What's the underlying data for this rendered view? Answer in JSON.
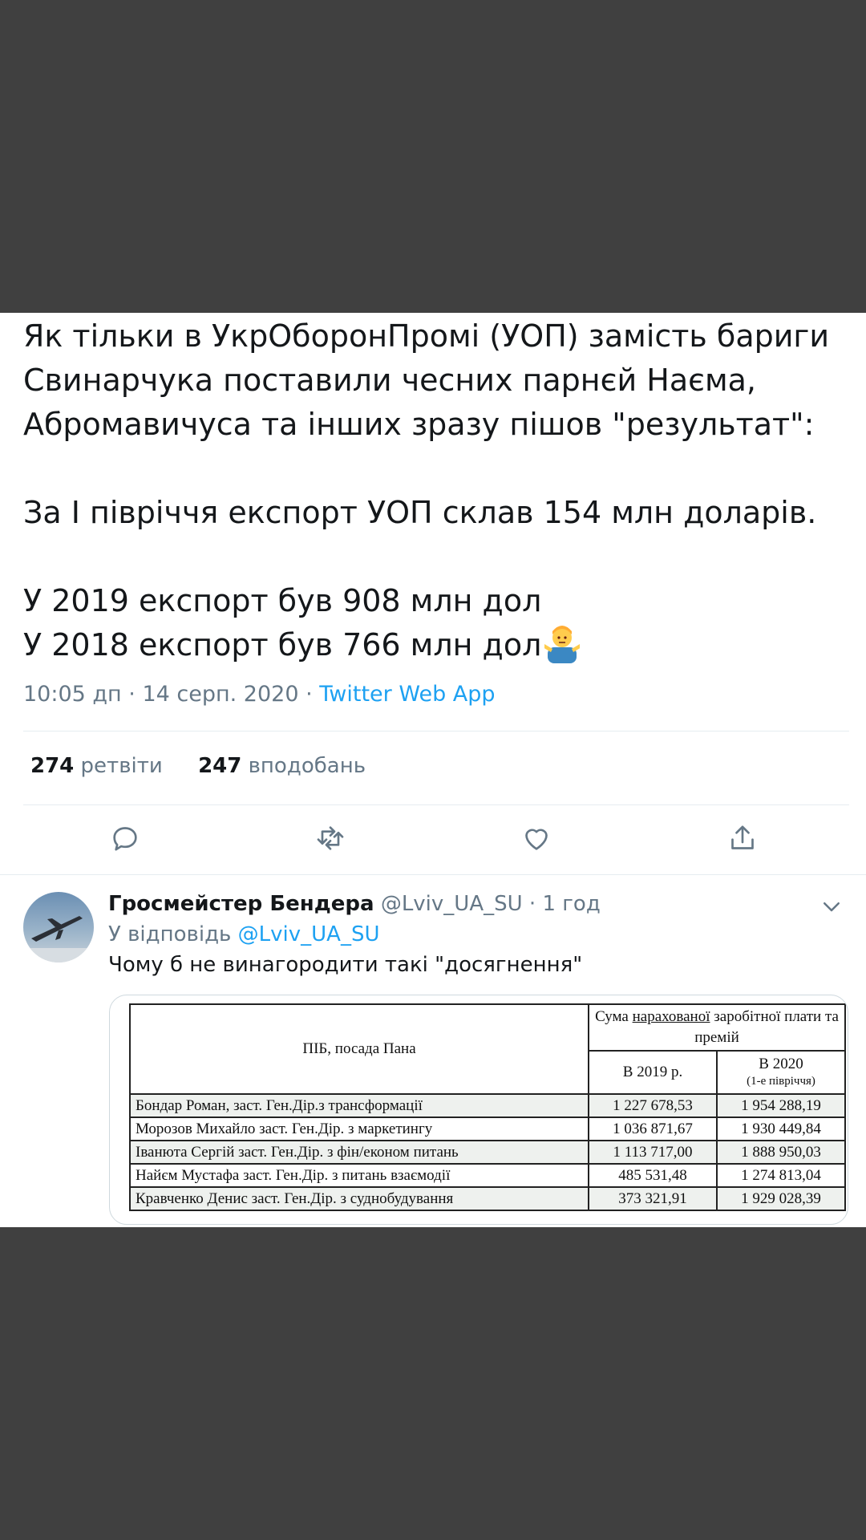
{
  "tweet": {
    "lines": [
      "Як тільки в УкрОборонПромі (УОП) замість бариги",
      "Свинарчука поставили чесних парнєй Наєма,",
      "Абромавичуса та інших зразу пішов \"результат\":",
      "",
      "За І півріччя експорт УОП склав 154 млн доларів.",
      "",
      "У 2019 експорт був 908 млн дол",
      "У 2018 експорт був 766 млн дол"
    ],
    "emoji": "person-shrugging-emoji",
    "time": "10:05 дп · 14 серп. 2020 · ",
    "app": "Twitter Web App",
    "retweets_count": "274",
    "retweets_label": "ретвіти",
    "likes_count": "247",
    "likes_label": "вподобань"
  },
  "actions": {
    "icons": [
      "reply-icon",
      "retweet-icon",
      "like-icon",
      "share-icon"
    ]
  },
  "reply": {
    "author_name": "Гросмейстер Бендера",
    "handle": "@Lviv_UA_SU",
    "time": " · 1 год",
    "replying_prefix": "У відповідь ",
    "replying_to": "@Lviv_UA_SU",
    "text": "Чому б не винагородити такі \"досягнення\"",
    "image": {
      "header_name": "ПІБ, посада Пана",
      "header_sum_part1": "Сума ",
      "header_sum_underlined": "нарахованої",
      "header_sum_part2": " заробітної плати та премій",
      "col_2019": "В 2019 р.",
      "col_2020": "В 2020",
      "col_2020_note": "(1-е півріччя)",
      "rows": [
        {
          "name": "Бондар Роман, заст. Ген.Дір.з трансформації",
          "v2019": "1 227 678,53",
          "v2020": "1 954 288,19"
        },
        {
          "name": "Морозов Михайло заст. Ген.Дір. з маркетингу",
          "v2019": "1 036 871,67",
          "v2020": "1 930 449,84"
        },
        {
          "name": "Іванюта Сергій заст. Ген.Дір. з фін/економ питань",
          "v2019": "1 113 717,00",
          "v2020": "1 888 950,03"
        },
        {
          "name": "Найєм Мустафа заст. Ген.Дір. з питань взаємодії",
          "v2019": "485 531,48",
          "v2020": "1 274 813,04"
        },
        {
          "name": "Кравченко Денис заст. Ген.Дір. з суднобудування",
          "v2019": "373 321,91",
          "v2020": "1 929 028,39"
        }
      ]
    }
  },
  "colors": {
    "background": "#404040",
    "card": "#ffffff",
    "text": "#14171a",
    "muted": "#657786",
    "accent": "#1da1f2"
  }
}
